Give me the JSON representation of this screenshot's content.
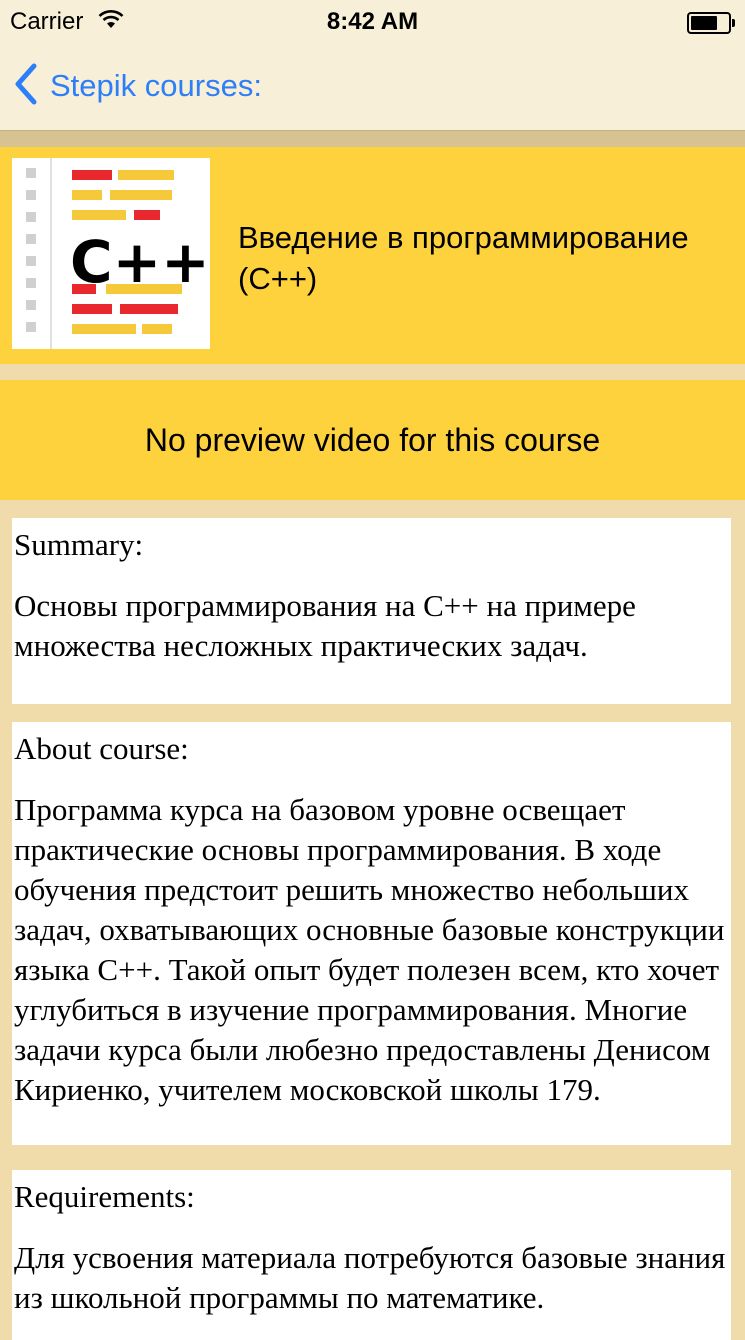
{
  "status_bar": {
    "carrier": "Carrier",
    "time": "8:42 AM"
  },
  "nav": {
    "back_label": "Stepik courses:",
    "accent_color": "#2d7ff9"
  },
  "course": {
    "title": "Введение в программирование (C++)",
    "logo_text": "C++"
  },
  "preview": {
    "message": "No preview video for this course"
  },
  "sections": [
    {
      "heading": "Summary:",
      "body": "Основы программирования на C++ на примере множества несложных практических задач."
    },
    {
      "heading": "About course:",
      "body": "Программа курса на базовом уровне освещает практические основы программирования. В ходе обучения предстоит решить множество небольших задач, охватывающих основные базовые конструкции языка C++. Такой опыт будет полезен всем, кто хочет углубиться в изучение программирования. Многие задачи курса были любезно предоставлены Денисом Кириенко, учителем московской школы 179."
    },
    {
      "heading": "Requirements:",
      "body": "Для усвоения материала потребуются базовые знания из школьной программы по математике."
    }
  ],
  "colors": {
    "header_bg": "#fdd23c",
    "page_bg": "#f0dcaa",
    "nav_bg": "#f7efd7"
  }
}
